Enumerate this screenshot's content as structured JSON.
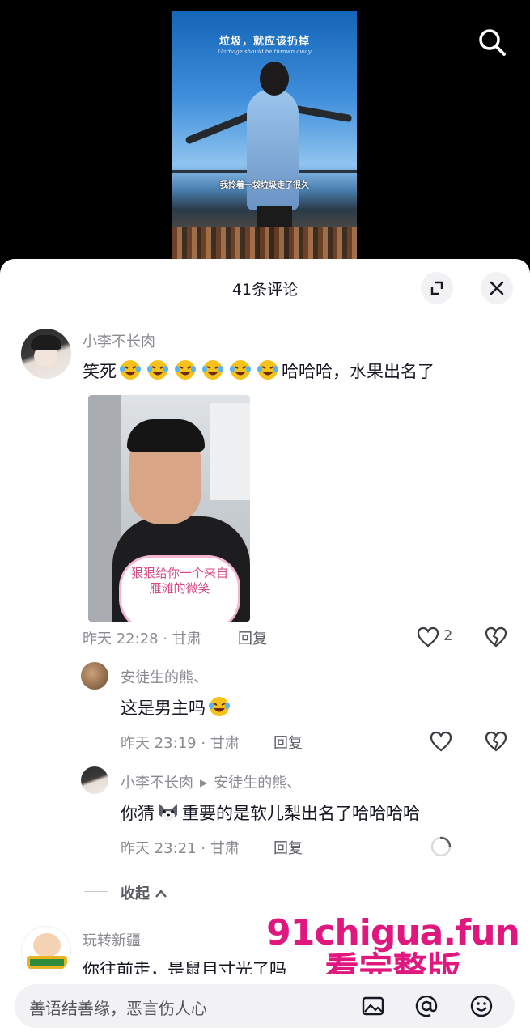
{
  "video": {
    "title": "垃圾，就应该扔掉",
    "subtitle": "Garbage should be thrown away",
    "caption": "我拎着一袋垃圾走了很久"
  },
  "sheet": {
    "title": "41条评论"
  },
  "comments": [
    {
      "username": "小李不长肉",
      "text_before": "笑死",
      "emoji_count": 6,
      "text_after": "哈哈哈，水果出名了",
      "sticker_text": "狠狠给你一个来自雁滩的微笑",
      "time_location": "昨天 22:28 · 甘肃",
      "reply_label": "回复",
      "like_count": "2"
    }
  ],
  "replies": [
    {
      "username": "安徒生的熊、",
      "text": "这是男主吗",
      "time_location": "昨天 23:19 · 甘肃",
      "reply_label": "回复"
    },
    {
      "username": "小李不长肉",
      "reply_to": "安徒生的熊、",
      "text_before": "你猜",
      "text_after": "重要的是软儿梨出名了哈哈哈哈",
      "time_location": "昨天 23:21 · 甘肃",
      "reply_label": "回复"
    }
  ],
  "collapse_label": "收起",
  "next_comment": {
    "username": "玩转新疆",
    "text": "你往前走，是鼠目寸光了吗"
  },
  "watermark": {
    "url": "91chigua.fun",
    "text": "看完整版"
  },
  "input": {
    "placeholder": "善语结善缘，恶言伤人心"
  },
  "colors": {
    "accent_pink": "#e0177f",
    "text_primary": "#161823",
    "text_secondary": "#8a8b91"
  }
}
